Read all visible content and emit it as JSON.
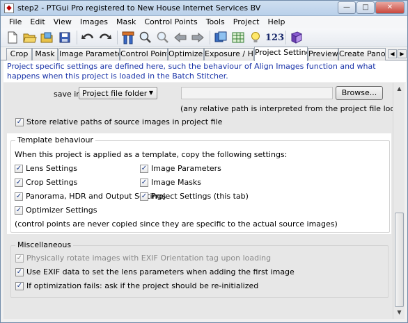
{
  "window": {
    "title": "step2 - PTGui Pro registered to New House Internet Services BV"
  },
  "menu": [
    "File",
    "Edit",
    "View",
    "Images",
    "Mask",
    "Control Points",
    "Tools",
    "Project",
    "Help"
  ],
  "toolbar": {
    "number_label": "123"
  },
  "tabs": [
    {
      "label": "Crop",
      "active": false
    },
    {
      "label": "Mask",
      "active": false
    },
    {
      "label": "Image Parameters",
      "active": false
    },
    {
      "label": "Control Points",
      "active": false
    },
    {
      "label": "Optimizer",
      "active": false
    },
    {
      "label": "Exposure / HDR",
      "active": false
    },
    {
      "label": "Project Settings",
      "active": true
    },
    {
      "label": "Preview",
      "active": false
    },
    {
      "label": "Create Panora",
      "active": false
    }
  ],
  "info": "Project specific settings are defined here, such the behaviour of Align Images function and what happens when this project is loaded in the Batch Stitcher.",
  "save": {
    "label": "save in",
    "select_value": "Project file folder",
    "browse_label": "Browse...",
    "relative_note": "(any relative path is interpreted from the project file location)",
    "relative_paths_label": "Store relative paths of source images in project file",
    "relative_paths_checked": true
  },
  "template": {
    "title": "Template behaviour",
    "intro": "When this project is applied as a template, copy the following settings:",
    "left": [
      {
        "label": "Lens Settings",
        "checked": true
      },
      {
        "label": "Crop Settings",
        "checked": true
      },
      {
        "label": "Panorama, HDR and Output Settings",
        "checked": true
      },
      {
        "label": "Optimizer Settings",
        "checked": true
      }
    ],
    "right": [
      {
        "label": "Image Parameters",
        "checked": true
      },
      {
        "label": "Image Masks",
        "checked": true
      },
      {
        "label": "Project Settings (this tab)",
        "checked": true
      }
    ],
    "note": "(control points are never copied since they are specific to the actual source images)"
  },
  "misc": {
    "title": "Miscellaneous",
    "items": [
      {
        "label": "Physically rotate images with EXIF Orientation tag upon loading",
        "checked": true,
        "disabled": true
      },
      {
        "label": "Use EXIF data to set the lens parameters when adding the first image",
        "checked": true,
        "disabled": false
      },
      {
        "label": "If optimization fails: ask if the project should be re-initialized",
        "checked": true,
        "disabled": false
      }
    ]
  }
}
